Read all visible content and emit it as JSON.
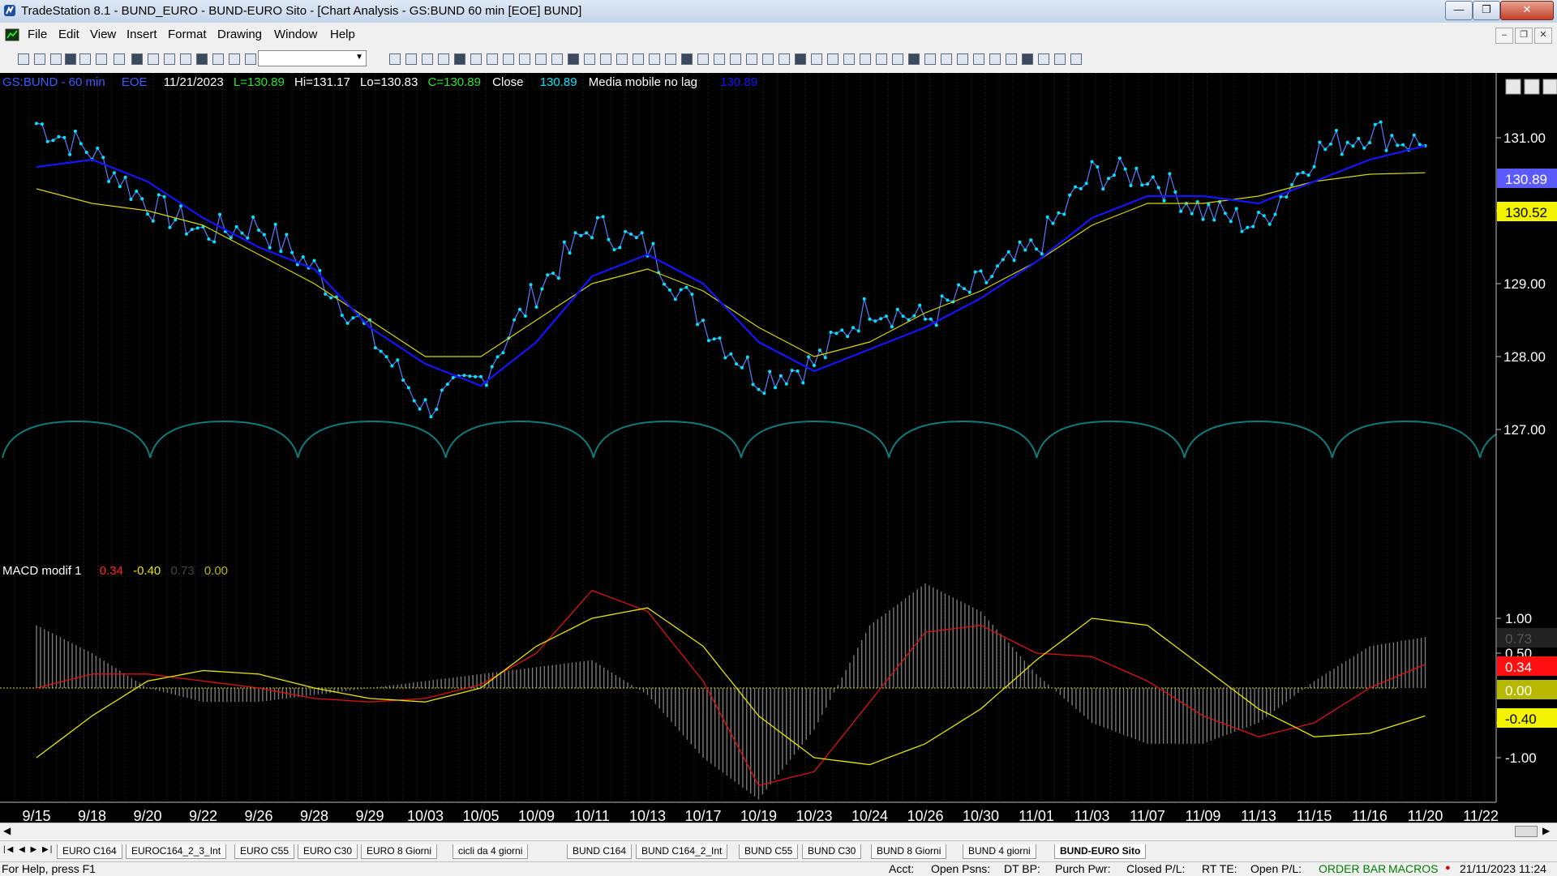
{
  "window": {
    "title": "TradeStation 8.1 - BUND_EURO - BUND-EURO Sito - [Chart Analysis - GS:BUND  60 min  [EOE] BUND]",
    "controls": {
      "minimize": "—",
      "maximize": "❐",
      "close": "✕"
    }
  },
  "menu": [
    "File",
    "Edit",
    "View",
    "Insert",
    "Format",
    "Drawing",
    "Window",
    "Help"
  ],
  "chart": {
    "symbol": "GS:BUND - 60 min",
    "exchange": "EOE",
    "date": "11/21/2023",
    "low_label": "L=130.89",
    "high_label": "Hi=131.17",
    "lo_label": "Lo=130.83",
    "close_label": "C=130.89",
    "close_word": "Close",
    "close_value": "130.89",
    "ma_name": "Media mobile no lag",
    "ma_value": "130.89",
    "price_ticks": [
      "131.00",
      "130.00",
      "129.00",
      "128.00",
      "127.00"
    ],
    "last_price_badge": "130.89",
    "ma_badge": "130.52",
    "date_ticks": [
      "9/15",
      "9/18",
      "9/20",
      "9/22",
      "9/26",
      "9/28",
      "9/29",
      "10/03",
      "10/05",
      "10/09",
      "10/11",
      "10/13",
      "10/17",
      "10/19",
      "10/23",
      "10/24",
      "10/26",
      "10/30",
      "11/01",
      "11/03",
      "11/07",
      "11/09",
      "11/13",
      "11/15",
      "11/16",
      "11/20",
      "11/22"
    ],
    "colors": {
      "price": "#00e5ff",
      "ma_blue": "#1414ff",
      "ma_yellow": "#d8d800",
      "cycles": "#0f7a7a",
      "macd": "#e01010",
      "signal": "#e6e600",
      "hist": "#7a7a7a"
    },
    "chart_data": {
      "type": "line",
      "title": "GS:BUND - 60 min",
      "ylim": [
        126.6,
        131.9
      ],
      "x": [
        "9/15",
        "9/18",
        "9/20",
        "9/22",
        "9/26",
        "9/28",
        "9/29",
        "10/03",
        "10/05",
        "10/09",
        "10/11",
        "10/13",
        "10/17",
        "10/19",
        "10/23",
        "10/24",
        "10/26",
        "10/30",
        "11/01",
        "11/03",
        "11/07",
        "11/09",
        "11/13",
        "11/15",
        "11/16",
        "11/20"
      ],
      "series": [
        {
          "name": "Close",
          "values": [
            131.2,
            130.8,
            130.1,
            129.7,
            129.8,
            129.2,
            128.3,
            127.3,
            127.7,
            128.9,
            129.8,
            129.5,
            128.5,
            127.7,
            127.9,
            128.7,
            128.5,
            129.0,
            129.5,
            130.5,
            130.5,
            130.0,
            129.8,
            130.8,
            131.1,
            130.89
          ]
        },
        {
          "name": "Media mobile no lag",
          "values": [
            130.6,
            130.7,
            130.4,
            129.9,
            129.5,
            129.2,
            128.4,
            127.9,
            127.6,
            128.2,
            129.1,
            129.4,
            129.0,
            128.2,
            127.8,
            128.1,
            128.4,
            128.8,
            129.3,
            129.9,
            130.2,
            130.2,
            130.1,
            130.4,
            130.7,
            130.89
          ]
        },
        {
          "name": "",
          "values": [
            130.3,
            130.1,
            130.0,
            129.8,
            129.4,
            129.0,
            128.5,
            128.0,
            128.0,
            128.5,
            129.0,
            129.2,
            128.9,
            128.4,
            128.0,
            128.2,
            128.6,
            128.9,
            129.3,
            129.8,
            130.1,
            130.1,
            130.2,
            130.4,
            130.5,
            130.52
          ]
        }
      ]
    }
  },
  "macd": {
    "name": "MACD modif 1",
    "values": [
      "0.34",
      "-0.40",
      "0.73",
      "0.00"
    ],
    "ticks": [
      "1.00",
      "0.50",
      "-0.50",
      "-1.00"
    ],
    "badges": [
      "0.73",
      "0.34",
      "0.00",
      "-0.40"
    ],
    "chart_data": {
      "type": "line",
      "title": "MACD modif 1",
      "ylim": [
        -1.6,
        1.5
      ],
      "x": [
        "9/15",
        "9/18",
        "9/20",
        "9/22",
        "9/26",
        "9/28",
        "9/29",
        "10/03",
        "10/05",
        "10/09",
        "10/11",
        "10/13",
        "10/17",
        "10/19",
        "10/23",
        "10/24",
        "10/26",
        "10/30",
        "11/01",
        "11/03",
        "11/07",
        "11/09",
        "11/13",
        "11/15",
        "11/16",
        "11/20"
      ],
      "series": [
        {
          "name": "MACD",
          "values": [
            0.0,
            0.2,
            0.2,
            0.1,
            0.0,
            -0.15,
            -0.2,
            -0.15,
            0.05,
            0.5,
            1.4,
            1.1,
            0.1,
            -1.4,
            -1.2,
            -0.2,
            0.8,
            0.9,
            0.5,
            0.45,
            0.1,
            -0.4,
            -0.7,
            -0.5,
            0.0,
            0.34
          ]
        },
        {
          "name": "Signal",
          "values": [
            -1.0,
            -0.4,
            0.1,
            0.25,
            0.2,
            0.0,
            -0.15,
            -0.2,
            0.0,
            0.6,
            1.0,
            1.15,
            0.6,
            -0.4,
            -1.0,
            -1.1,
            -0.8,
            -0.3,
            0.4,
            1.0,
            0.9,
            0.3,
            -0.3,
            -0.7,
            -0.65,
            -0.4
          ]
        },
        {
          "name": "Histogram",
          "values": [
            0.9,
            0.5,
            0.0,
            -0.2,
            -0.2,
            -0.1,
            0.0,
            0.1,
            0.2,
            0.3,
            0.4,
            -0.1,
            -1.0,
            -1.6,
            -0.6,
            0.9,
            1.5,
            1.1,
            0.2,
            -0.5,
            -0.8,
            -0.8,
            -0.5,
            0.1,
            0.6,
            0.73
          ]
        }
      ]
    }
  },
  "tabs": [
    "EURO C164",
    "EUROC164_2_3_Int",
    "EURO C55",
    "EURO C30",
    "EURO 8 Giorni",
    "cicli da 4 giorni",
    "BUND C164",
    "BUND C164_2_Int",
    "BUND C55",
    "BUND  C30",
    "BUND 8 Giorni",
    "BUND 4 giorni",
    "BUND-EURO Sito"
  ],
  "status": {
    "help": "For Help, press F1",
    "acct": "Acct:",
    "open_psns": "Open Psns:",
    "dt_bp": "DT BP:",
    "purch_pwr": "Purch Pwr:",
    "closed_pl": "Closed P/L:",
    "rt_te": "RT TE:",
    "open_pl": "Open P/L:",
    "order_bar": "ORDER BAR",
    "macros": "MACROS",
    "datetime": "21/11/2023 11:24"
  }
}
